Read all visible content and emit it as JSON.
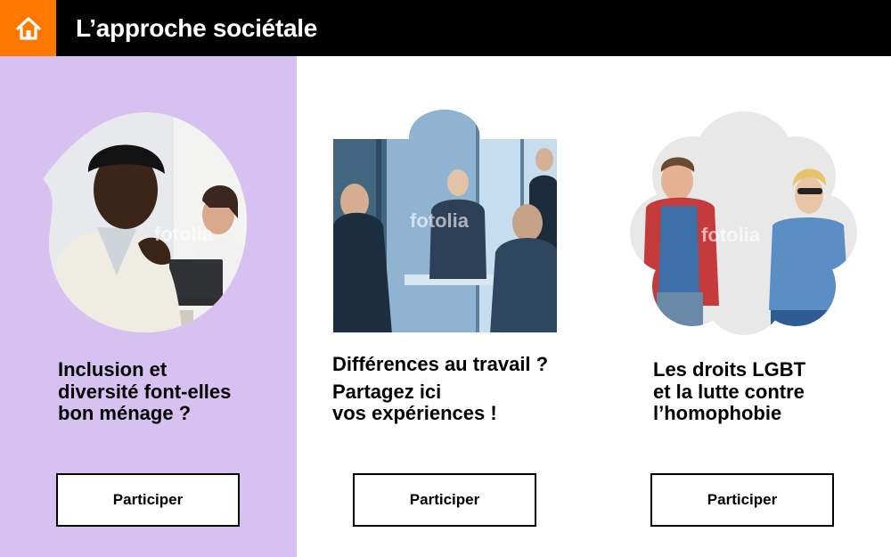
{
  "header": {
    "title": "L’approche sociétale",
    "home_icon": "home-icon",
    "colors": {
      "bar": "#000000",
      "home_button": "#ff7900"
    }
  },
  "cards": [
    {
      "title_lines": [
        "Inclusion et",
        "diversité font-elles",
        "bon ménage ?"
      ],
      "button_label": "Participer",
      "background": "#d7c1f1",
      "image_watermark": "fotolia"
    },
    {
      "title_line_1": "Différences au travail ?",
      "title_lines": [
        "Partagez ici",
        "vos expériences !"
      ],
      "button_label": "Participer",
      "background": "#ffffff",
      "image_watermark": "fotolia"
    },
    {
      "title_lines": [
        "Les droits LGBT",
        "et la lutte contre",
        "l’homophobie"
      ],
      "button_label": "Participer",
      "background": "#ffffff",
      "image_watermark": "fotolia"
    }
  ]
}
